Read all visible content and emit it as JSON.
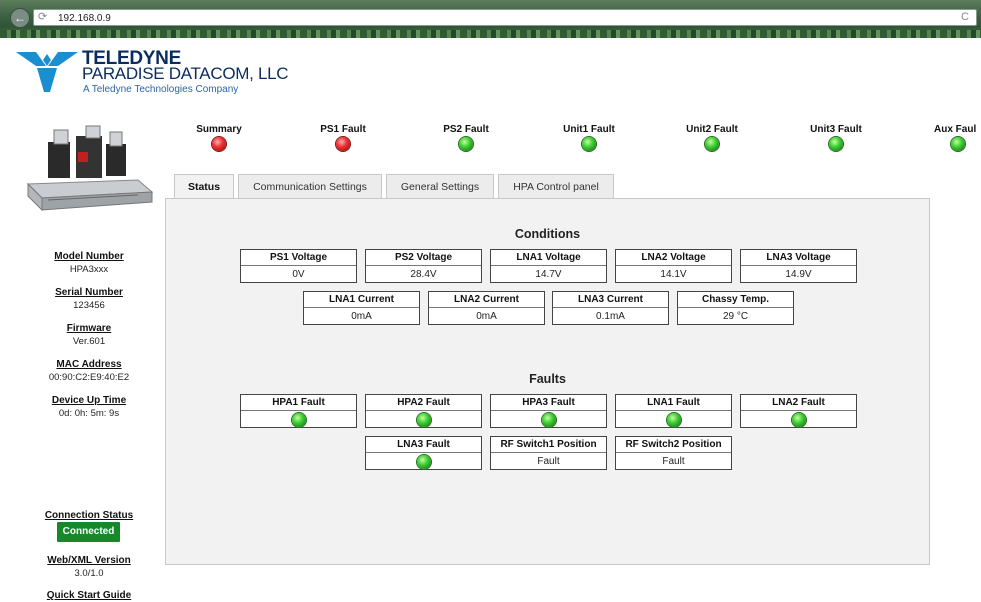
{
  "browser": {
    "url": "192.168.0.9",
    "back_glyph": "←",
    "page_glyph": "⟳",
    "reload_glyph": "C"
  },
  "logo": {
    "name": "TELEDYNE",
    "sub": "PARADISE DATACOM, LLC",
    "tag": "A Teledyne Technologies Company",
    "brand_color": "#0b2c5e"
  },
  "sidebar": {
    "model_label": "Model Number",
    "model_value": "HPA3xxx",
    "serial_label": "Serial Number",
    "serial_value": "123456",
    "firmware_label": "Firmware",
    "firmware_value": "Ver.601",
    "mac_label": "MAC Address",
    "mac_value": "00:90:C2:E9:40:E2",
    "uptime_label": "Device Up Time",
    "uptime_value": "0d: 0h: 5m: 9s",
    "conn_label": "Connection Status",
    "conn_value": "Connected",
    "webxml_label": "Web/XML Version",
    "webxml_value": "3.0/1.0",
    "quickstart_label": "Quick Start Guide"
  },
  "indicators": [
    {
      "label": "Summary",
      "state": "red"
    },
    {
      "label": "PS1 Fault",
      "state": "red"
    },
    {
      "label": "PS2 Fault",
      "state": "green"
    },
    {
      "label": "Unit1 Fault",
      "state": "green"
    },
    {
      "label": "Unit2 Fault",
      "state": "green"
    },
    {
      "label": "Unit3 Fault",
      "state": "green"
    },
    {
      "label": "Aux Faul",
      "state": "green"
    }
  ],
  "tabs": [
    "Status",
    "Communication Settings",
    "General Settings",
    "HPA Control panel"
  ],
  "conditions": {
    "title": "Conditions",
    "row1": [
      {
        "label": "PS1 Voltage",
        "value": "0V"
      },
      {
        "label": "PS2 Voltage",
        "value": "28.4V"
      },
      {
        "label": "LNA1 Voltage",
        "value": "14.7V"
      },
      {
        "label": "LNA2 Voltage",
        "value": "14.1V"
      },
      {
        "label": "LNA3 Voltage",
        "value": "14.9V"
      }
    ],
    "row2": [
      {
        "label": "LNA1 Current",
        "value": "0mA"
      },
      {
        "label": "LNA2 Current",
        "value": "0mA"
      },
      {
        "label": "LNA3 Current",
        "value": "0.1mA"
      },
      {
        "label": "Chassy Temp.",
        "value": "29 °C"
      }
    ]
  },
  "faults": {
    "title": "Faults",
    "row1": [
      {
        "label": "HPA1 Fault",
        "state": "green"
      },
      {
        "label": "HPA2 Fault",
        "state": "green"
      },
      {
        "label": "HPA3 Fault",
        "state": "green"
      },
      {
        "label": "LNA1 Fault",
        "state": "green"
      },
      {
        "label": "LNA2 Fault",
        "state": "green"
      }
    ],
    "row2": [
      {
        "label": "LNA3 Fault",
        "state": "green"
      },
      {
        "label": "RF Switch1 Position",
        "value": "Fault"
      },
      {
        "label": "RF Switch2 Position",
        "value": "Fault"
      }
    ]
  }
}
